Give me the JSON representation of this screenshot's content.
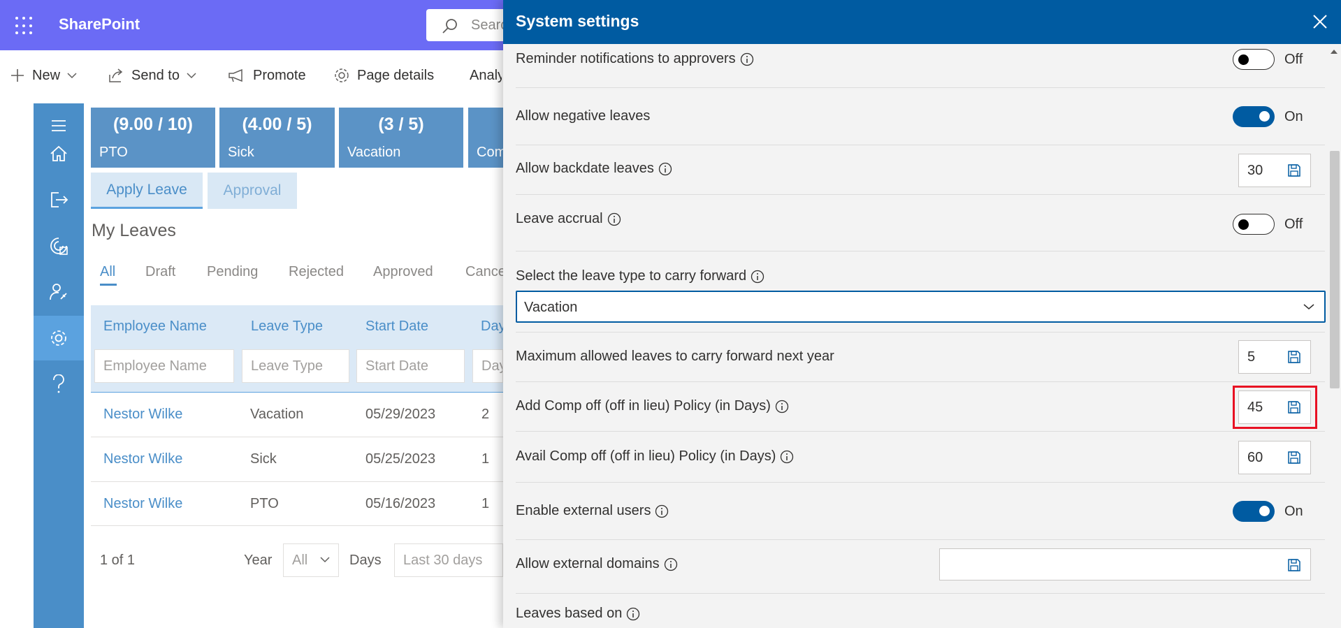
{
  "suitebar": {
    "brand": "SharePoint",
    "search_placeholder": "Search"
  },
  "commands": {
    "new": "New",
    "send_to": "Send to",
    "promote": "Promote",
    "page_details": "Page details",
    "analytics": "Analytics"
  },
  "tiles": [
    {
      "count": "(9.00 / 10)",
      "label": "PTO"
    },
    {
      "count": "(4.00 / 5)",
      "label": "Sick"
    },
    {
      "count": "(3 / 5)",
      "label": "Vacation"
    },
    {
      "count": "",
      "label": "Comp off"
    }
  ],
  "actions": {
    "apply": "Apply Leave",
    "approval": "Approval"
  },
  "my_leaves": {
    "title": "My Leaves",
    "tabs": [
      "All",
      "Draft",
      "Pending",
      "Rejected",
      "Approved",
      "Cancelled"
    ],
    "columns": [
      "Employee Name",
      "Leave Type",
      "Start Date",
      "Days"
    ],
    "filter_placeholders": [
      "Employee Name",
      "Leave Type",
      "Start Date",
      "Days"
    ],
    "rows": [
      {
        "name": "Nestor Wilke",
        "type": "Vacation",
        "start": "05/29/2023",
        "days": "2"
      },
      {
        "name": "Nestor Wilke",
        "type": "Sick",
        "start": "05/25/2023",
        "days": "1"
      },
      {
        "name": "Nestor Wilke",
        "type": "PTO",
        "start": "05/16/2023",
        "days": "1"
      }
    ],
    "pager": "1 of 1",
    "year_label": "Year",
    "year_value": "All",
    "days_label": "Days",
    "days_value": "Last 30 days"
  },
  "panel": {
    "title": "System settings",
    "reminder_label": "Reminder notifications to approvers",
    "reminder_state": "Off",
    "negative_label": "Allow negative leaves",
    "negative_state": "On",
    "backdate_label": "Allow backdate leaves",
    "backdate_value": "30",
    "accrual_label": "Leave accrual",
    "accrual_state": "Off",
    "carry_type_label": "Select the leave type to carry forward",
    "carry_type_value": "Vacation",
    "carry_max_label": "Maximum allowed leaves to carry forward next year",
    "carry_max_value": "5",
    "add_comp_label": "Add Comp off (off in lieu) Policy (in Days)",
    "add_comp_value": "45",
    "avail_comp_label": "Avail Comp off (off in lieu) Policy (in Days)",
    "avail_comp_value": "60",
    "external_users_label": "Enable external users",
    "external_users_state": "On",
    "external_domains_label": "Allow external domains",
    "external_domains_value": "",
    "leaves_based_label": "Leaves based on"
  },
  "colors": {
    "suitebar": "#6b6bf5",
    "panel_header": "#005ba1",
    "rail": "#4a8ec8",
    "highlight": "#e81123"
  }
}
